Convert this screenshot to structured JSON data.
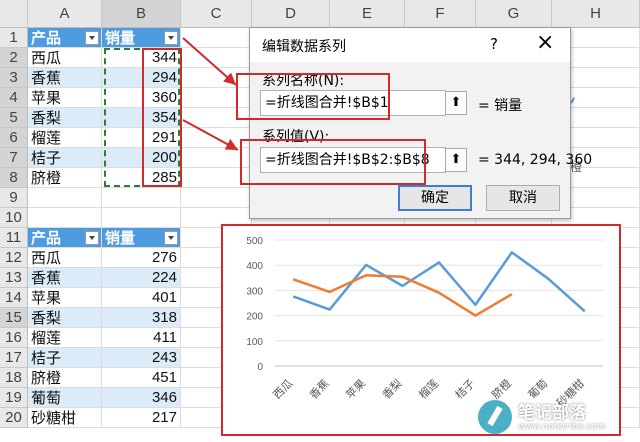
{
  "columns": [
    "A",
    "B",
    "C",
    "D",
    "E",
    "F",
    "G",
    "H"
  ],
  "rows": [
    "1",
    "2",
    "3",
    "4",
    "5",
    "6",
    "7",
    "8",
    "9",
    "10",
    "11",
    "12",
    "13",
    "14",
    "15",
    "16",
    "17",
    "18",
    "19",
    "20"
  ],
  "table1": {
    "header": [
      "产品",
      "销量"
    ],
    "items": [
      {
        "name": "西瓜",
        "value": "344"
      },
      {
        "name": "香蕉",
        "value": "294"
      },
      {
        "name": "苹果",
        "value": "360"
      },
      {
        "name": "香梨",
        "value": "354"
      },
      {
        "name": "榴莲",
        "value": "291"
      },
      {
        "name": "桔子",
        "value": "200"
      },
      {
        "name": "脐橙",
        "value": "285"
      }
    ]
  },
  "table2": {
    "header": [
      "产品",
      "销量"
    ],
    "items": [
      {
        "name": "西瓜",
        "value": "276"
      },
      {
        "name": "香蕉",
        "value": "224"
      },
      {
        "name": "苹果",
        "value": "401"
      },
      {
        "name": "香梨",
        "value": "318"
      },
      {
        "name": "榴莲",
        "value": "411"
      },
      {
        "name": "桔子",
        "value": "243"
      },
      {
        "name": "脐橙",
        "value": "451"
      },
      {
        "name": "葡萄",
        "value": "346"
      },
      {
        "name": "砂糖柑",
        "value": "217"
      }
    ]
  },
  "dialog": {
    "title": "编辑数据系列",
    "help": "?",
    "close": "×",
    "series_name_label": "系列名称(N):",
    "series_name_value": "=折线图合并!$B$1",
    "series_name_preview": "= 销量",
    "series_values_label": "系列值(V):",
    "series_values_value": "=折线图合并!$B$2:$B$8",
    "series_values_preview": "= 344, 294, 360",
    "ok": "确定",
    "cancel": "取消",
    "collapse_glyph": "⬆"
  },
  "background_chart_fragment": "橙",
  "watermark": {
    "name": "笔记部落",
    "url": "www.notetribe.com"
  },
  "colors": {
    "table_header": "#4f9be0",
    "series_blue": "#5b9bd5",
    "series_orange": "#ed7d31",
    "highlight_red": "#d22a2a",
    "marquee": "#2e7d32"
  },
  "chart_data": {
    "type": "line",
    "categories": [
      "西瓜",
      "香蕉",
      "苹果",
      "香梨",
      "榴莲",
      "桔子",
      "脐橙",
      "葡萄",
      "砂糖柑"
    ],
    "y_ticks": [
      "0",
      "100",
      "200",
      "300",
      "400",
      "500"
    ],
    "ylim": [
      0,
      500
    ],
    "series": [
      {
        "values": [
          276,
          224,
          401,
          318,
          411,
          243,
          451,
          346,
          217
        ],
        "color": "#5b9bd5"
      },
      {
        "values": [
          344,
          294,
          360,
          354,
          291,
          200,
          285
        ],
        "color": "#ed7d31"
      }
    ]
  }
}
